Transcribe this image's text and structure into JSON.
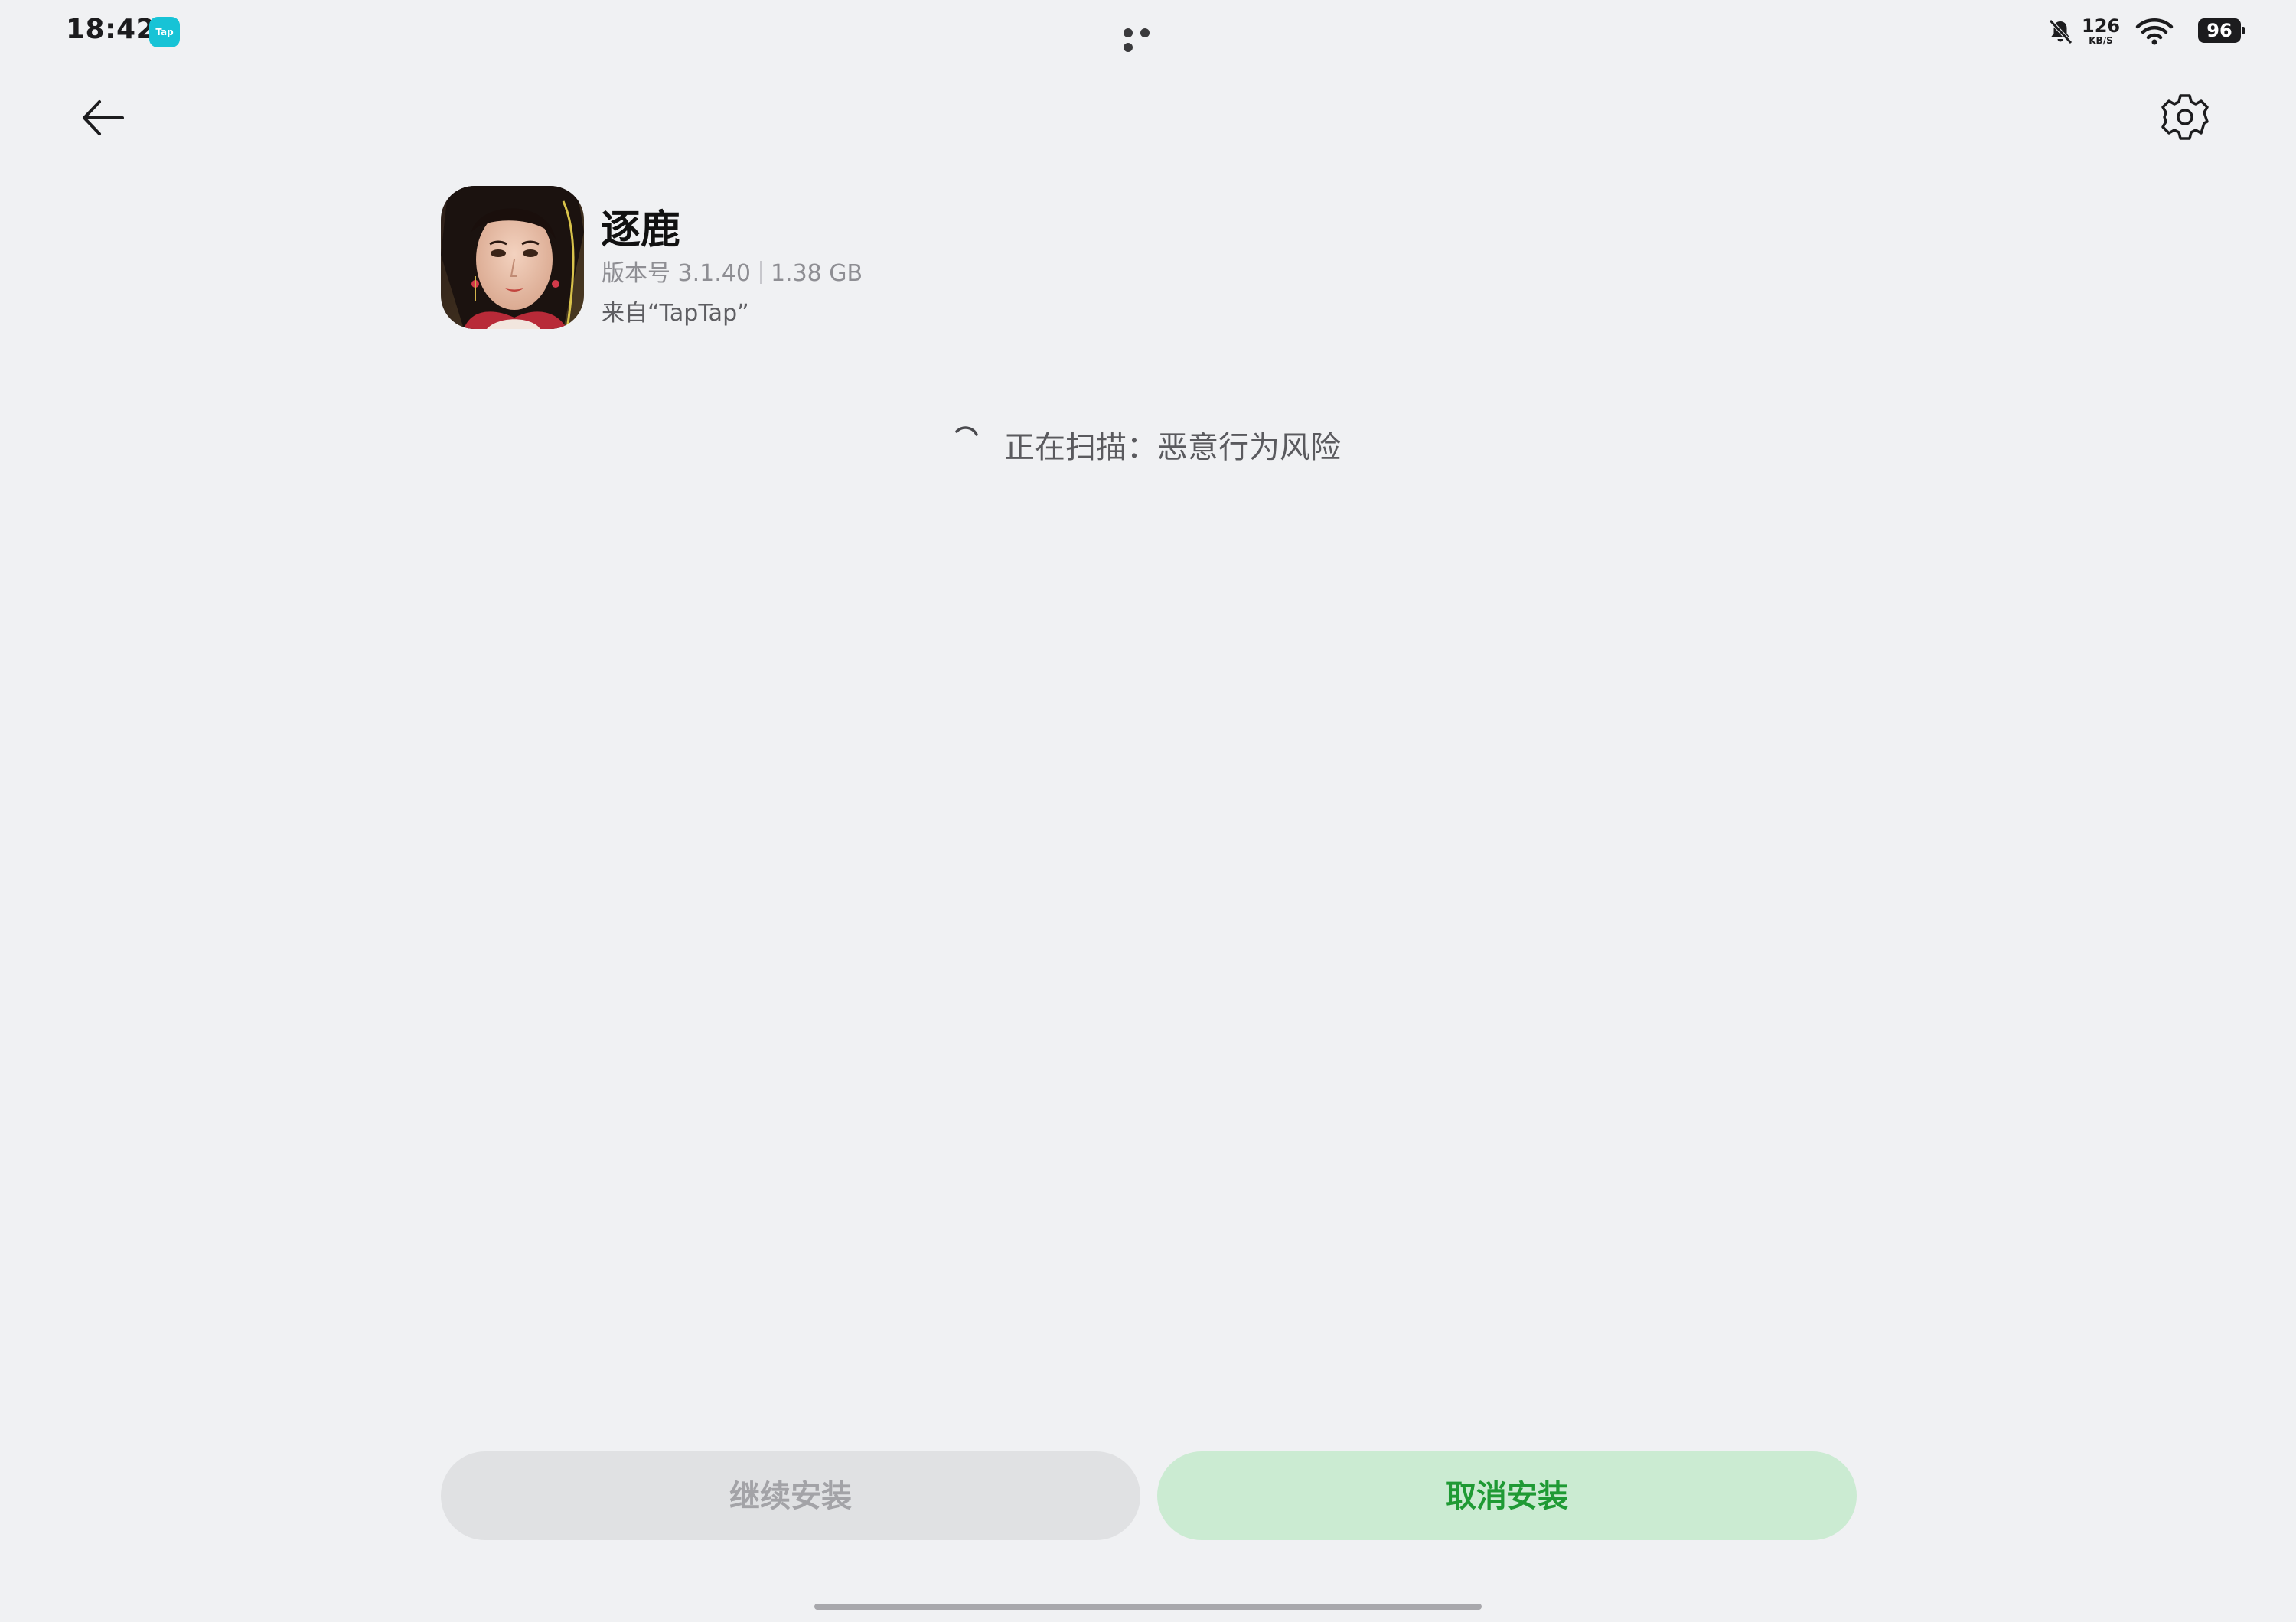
{
  "status_bar": {
    "time": "18:42",
    "app_icon_label": "Tap",
    "icons": [
      "mute-bell-icon",
      "wifi-icon"
    ],
    "network_speed": "126",
    "network_speed_unit": "KB/S",
    "battery": "96"
  },
  "header": {
    "back_icon": "arrow-left-icon",
    "settings_icon": "gear-icon"
  },
  "app": {
    "name": "逐鹿",
    "version": "版本号 3.1.40",
    "size": "1.38 GB",
    "source": "来自“TapTap”"
  },
  "scan": {
    "status_text": "正在扫描：恶意行为风险"
  },
  "actions": {
    "continue_label": "继续安装",
    "cancel_label": "取消安装"
  },
  "colors": {
    "background": "#f0f1f3",
    "cancel_button_bg": "#cbebd2",
    "cancel_button_text": "#1f9a34",
    "continue_button_bg": "#e0e1e3",
    "continue_button_text": "#a3a3a7"
  }
}
